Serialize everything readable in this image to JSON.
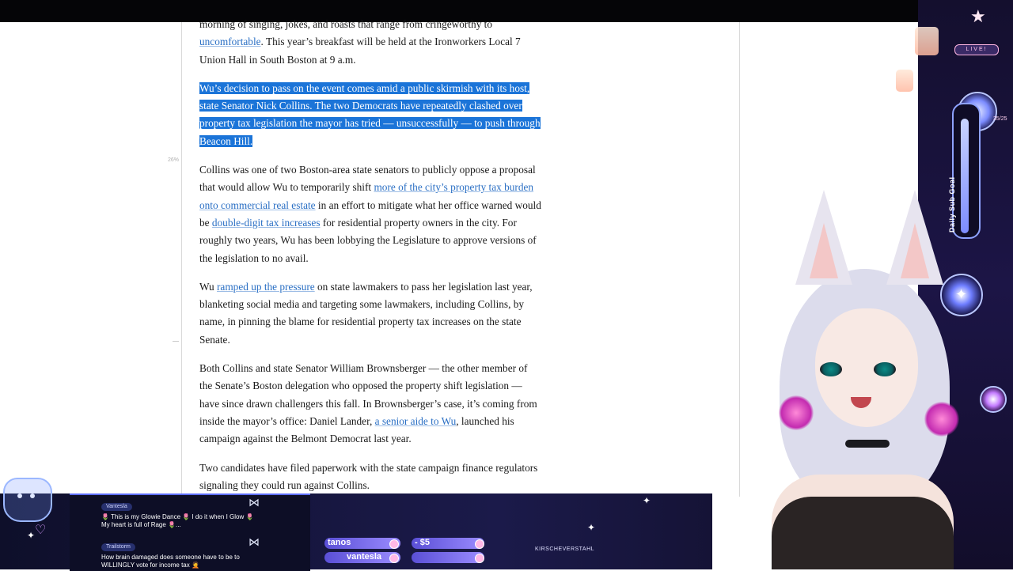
{
  "article": {
    "paragraphs": [
      {
        "parts": [
          {
            "text": "morning of singing, jokes, and roasts that range from cringeworthy to "
          },
          {
            "text": "uncomfortable",
            "link": true
          },
          {
            "text": ". This year’s breakfast will be held at the Ironworkers Local 7 Union Hall in South Boston at 9 a.m."
          }
        ]
      },
      {
        "selected": true,
        "parts": [
          {
            "text": "Wu’s decision to pass on the event comes amid a public skirmish with its host, state Senator Nick Collins. The two Democrats have repeatedly clashed over property tax legislation the mayor has tried — unsuccessfully — to push through Beacon Hill."
          }
        ]
      },
      {
        "parts": [
          {
            "text": "Collins was one of two Boston-area state senators to publicly oppose a proposal that would allow Wu to temporarily shift "
          },
          {
            "text": "more of the city’s property tax burden onto commercial real estate",
            "link": true
          },
          {
            "text": " in an effort to mitigate what her office warned would be "
          },
          {
            "text": "double-digit tax increases",
            "link": true
          },
          {
            "text": " for residential property owners in the city. For roughly two years, Wu has been lobbying the Legislature to approve versions of the legislation to no avail."
          }
        ]
      },
      {
        "parts": [
          {
            "text": "Wu "
          },
          {
            "text": "ramped up the pressure",
            "link": true
          },
          {
            "text": " on state lawmakers to pass her legislation last year, blanketing social media and targeting some lawmakers, including Collins, by name, in pinning the blame for residential property tax increases on the state Senate."
          }
        ]
      },
      {
        "parts": [
          {
            "text": "Both Collins and state Senator William Brownsberger — the other member of the Senate’s Boston delegation who opposed the property shift legislation — have since drawn challengers this fall. In Brownsberger’s case, it’s coming from inside the mayor’s office: Daniel Lander, "
          },
          {
            "text": "a senior aide to Wu",
            "link": true
          },
          {
            "text": ", launched his campaign against the Belmont Democrat last year."
          }
        ]
      },
      {
        "parts": [
          {
            "text": "Two candidates have filed paperwork with the state campaign finance regulators signaling they could run against Collins."
          }
        ]
      }
    ],
    "margin_note": "26%"
  },
  "chat": {
    "messages": [
      {
        "user": "Vantesla",
        "text": "🌷 This is my Glowie Dance 🌷 I do it when I Glow 🌷 My heart is full of Rage 🌷..."
      },
      {
        "user": "Trailstorm",
        "text": "How brain damaged does someone have to be to WILLINGLY vote for income tax 🤦"
      }
    ]
  },
  "ticker": {
    "row1_name": "tanos",
    "row1_amount": "- $5",
    "row2_name": "vantesla",
    "tag": "KIRSCHEVERSTAHL"
  },
  "overlay": {
    "live_label": "LIVE!",
    "goal_label": "Daily Sub Goal",
    "goal_count": "35/25",
    "goal_progress": 1.0
  },
  "colors": {
    "link": "#2a6fc4",
    "selection": "#1b74d8",
    "overlay_accent": "#8ea2ff"
  },
  "icons": [
    "mouse-cursor-icon",
    "bow-icon",
    "heart-icon",
    "sparkle-icon",
    "gem-icon",
    "star-icon"
  ]
}
